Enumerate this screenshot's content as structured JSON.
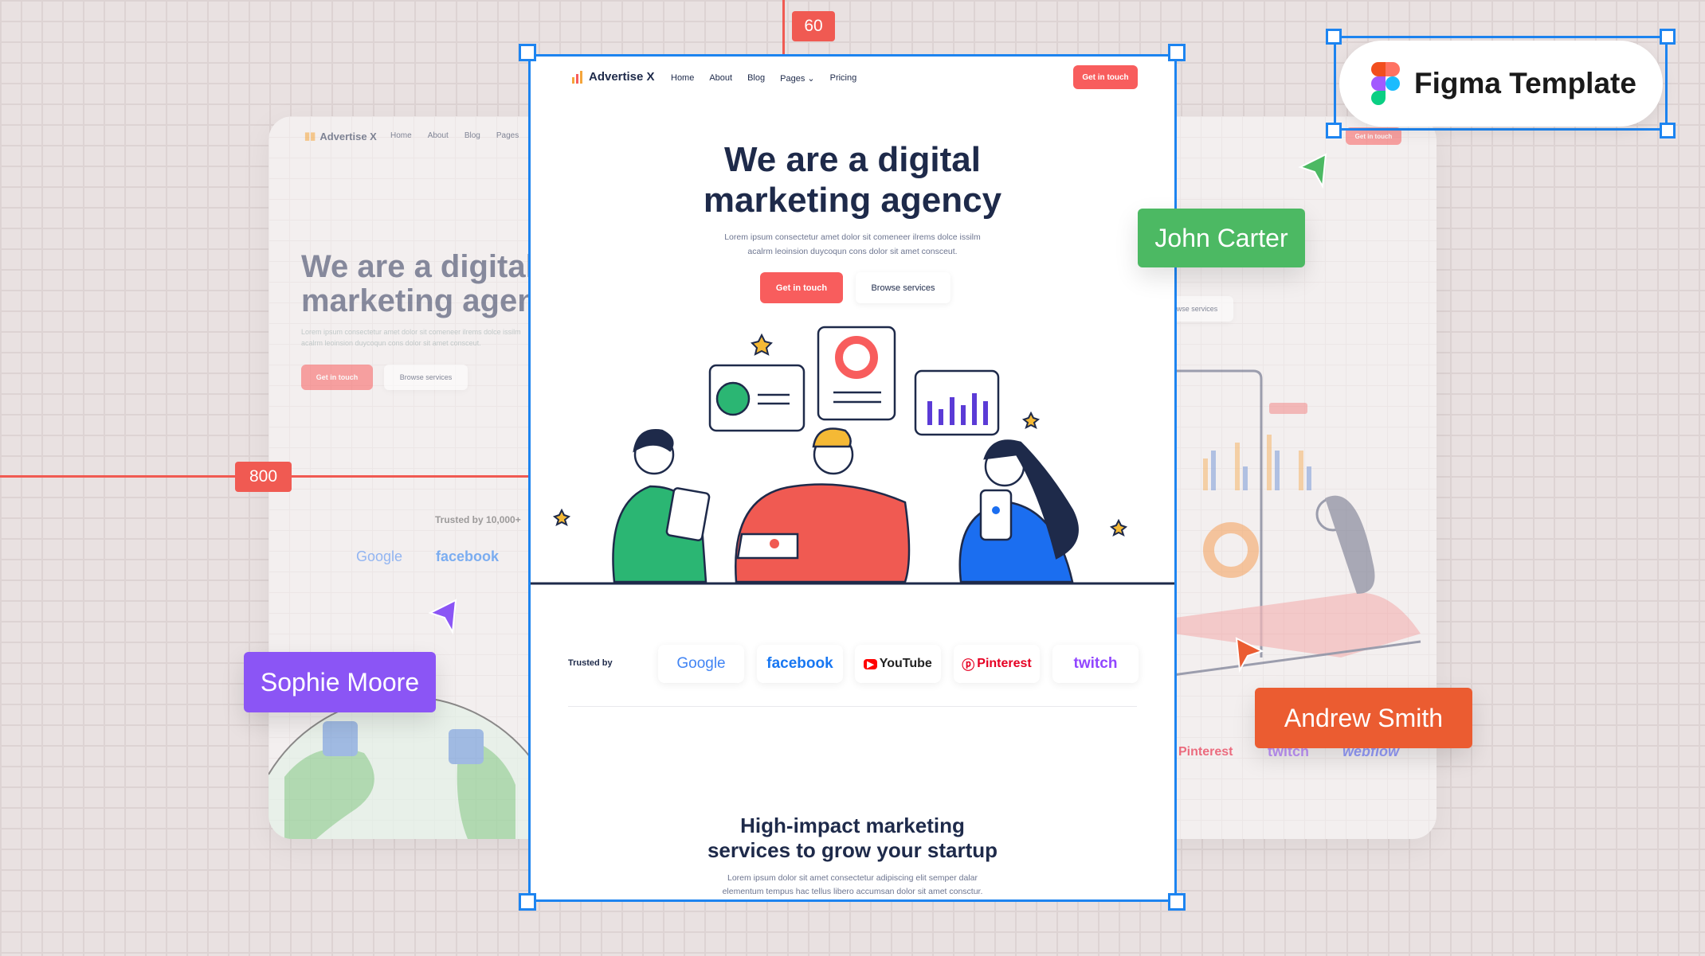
{
  "rulers": {
    "top": "60",
    "left": "800"
  },
  "site": {
    "brand": "Advertise X",
    "nav": [
      "Home",
      "About",
      "Blog",
      "Pages",
      "Pricing"
    ],
    "nav_cta": "Get in touch",
    "hero_title_1": "We are a digital",
    "hero_title_2": "marketing agency",
    "hero_text_1": "Lorem ipsum consectetur amet dolor sit comeneer ilrems dolce issilm",
    "hero_text_2": "acalrm leoinsion duycoqun cons dolor sit amet consceut.",
    "cta_primary": "Get in touch",
    "cta_secondary": "Browse services",
    "trusted_label": "Trusted by",
    "trusted_label_long": "Trusted by 10,000+",
    "logos": [
      "Google",
      "facebook",
      "YouTube",
      "Pinterest",
      "twitch",
      "webflow"
    ],
    "section_title_1": "High-impact marketing",
    "section_title_2": "services to grow your startup",
    "section_text_1": "Lorem ipsum dolor sit amet consectetur adipiscing elit semper dalar",
    "section_text_2": "elementum tempus hac tellus libero accumsan dolor sit amet consctur."
  },
  "badge": {
    "label": "Figma Template"
  },
  "collaborators": [
    {
      "name": "John Carter",
      "color": "#4cb963"
    },
    {
      "name": "Sophie Moore",
      "color": "#8b55f5"
    },
    {
      "name": "Andrew Smith",
      "color": "#eb5c31"
    }
  ],
  "colors": {
    "accent": "#f85d5d",
    "selection": "#1d84f0",
    "navy": "#1e2a4a"
  }
}
